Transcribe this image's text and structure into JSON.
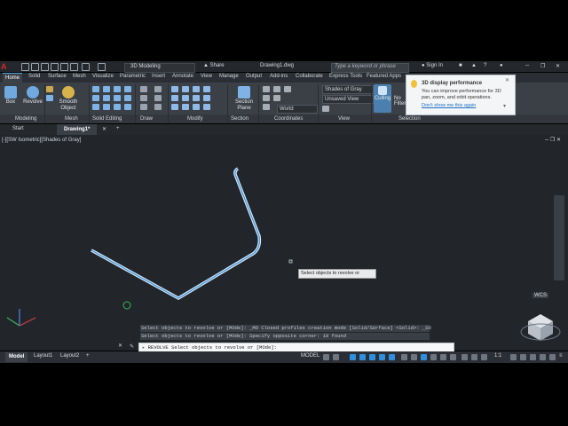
{
  "titlebar": {
    "app_logo": "A",
    "workspace": "3D Modeling",
    "share": "Share",
    "title": "Drawing1.dwg",
    "search_placeholder": "Type a keyword or phrase",
    "sign_in": "Sign In"
  },
  "tabs": [
    "Home",
    "Solid",
    "Surface",
    "Mesh",
    "Visualize",
    "Parametric",
    "Insert",
    "Annotate",
    "View",
    "Manage",
    "Output",
    "Add-ins",
    "Collaborate",
    "Express Tools",
    "Featured Apps"
  ],
  "ribbon": {
    "box": "Box",
    "revolve": "Revolve",
    "smooth_object": "Smooth Object",
    "section_plane": "Section Plane",
    "visual_style": "Shades of Gray",
    "view_combo": "Unsaved View",
    "world": "World",
    "culling": "Culling",
    "no_filter": "No Filter",
    "panels": [
      "Modeling",
      "Mesh",
      "Solid Editing",
      "Draw",
      "Modify",
      "Section",
      "Coordinates",
      "View",
      "Selection"
    ]
  },
  "tooltip": {
    "title": "3D display performance",
    "body": "You can improve performance for 3D pan, zoom, and orbit operations.",
    "link": "Don't show me this again"
  },
  "doc_tabs": {
    "start": "Start",
    "drawing": "Drawing1*"
  },
  "viewport": {
    "label": "[-][SW Isometric][Shades of Gray]",
    "wcs": "WCS",
    "cursor_tip": "Select objects to revolve or"
  },
  "command": {
    "history": [
      "Select objects to revolve or [MOde]: _MO Closed profiles creation mode [Solid/SUrface] <Solid>: _SO",
      "Select objects to revolve or [MOde]: Specify opposite corner: 10 found"
    ],
    "prompt": "REVOLVE Select objects to revolve or [MOde]:"
  },
  "status": {
    "tabs": [
      "Model",
      "Layout1",
      "Layout2"
    ],
    "model_label": "MODEL",
    "scale": "1:1"
  },
  "colors": {
    "accent": "#2f8ee0",
    "profile": "#9fd0f5",
    "viewport_bg": "#22262b"
  }
}
